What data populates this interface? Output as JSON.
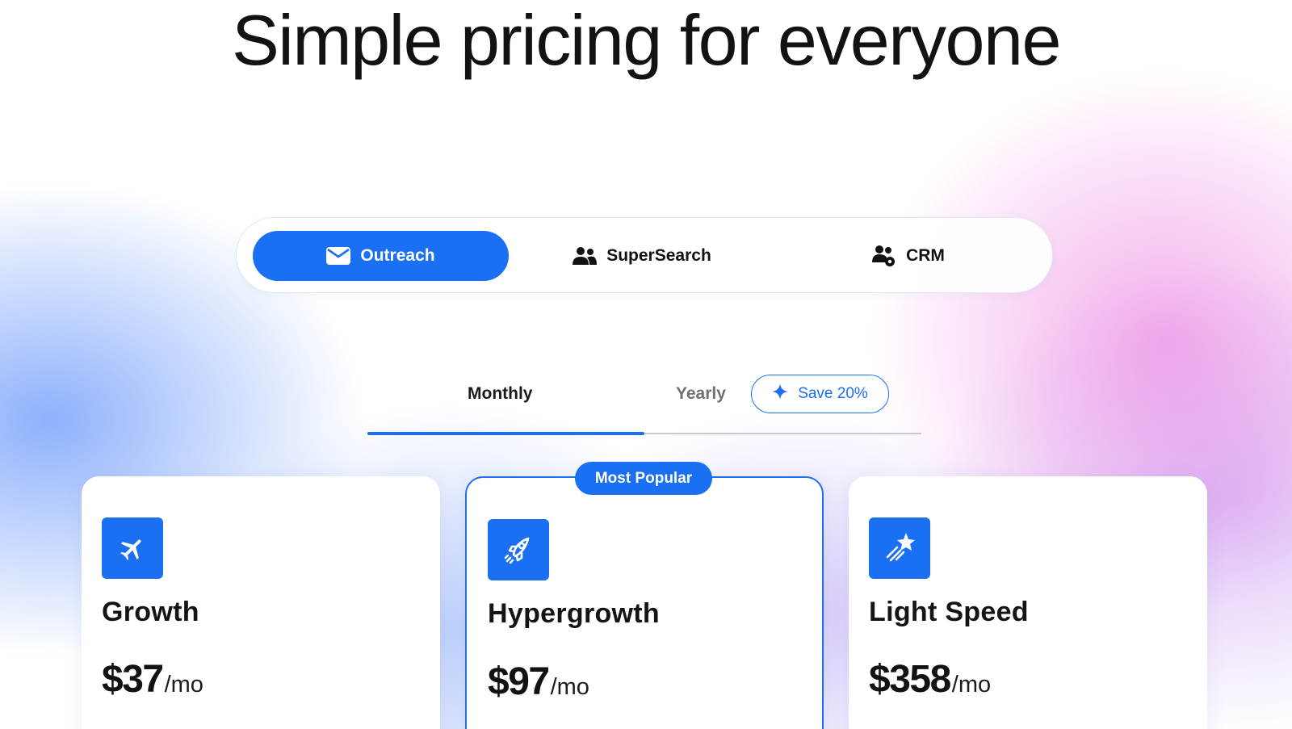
{
  "headline": "Simple pricing for everyone",
  "product_tabs": [
    {
      "label": "Outreach",
      "icon": "envelope-icon",
      "active": true
    },
    {
      "label": "SuperSearch",
      "icon": "users-icon",
      "active": false
    },
    {
      "label": "CRM",
      "icon": "users-gear-icon",
      "active": false
    }
  ],
  "billing": {
    "monthly_label": "Monthly",
    "yearly_label": "Yearly",
    "save_label": "Save 20%",
    "save_icon": "sparkle-icon",
    "selected": "Monthly"
  },
  "popular_badge": "Most Popular",
  "plans": [
    {
      "name": "Growth",
      "price": "$37",
      "unit": "/mo",
      "icon": "airplane-icon"
    },
    {
      "name": "Hypergrowth",
      "price": "$97",
      "unit": "/mo",
      "icon": "rocket-icon",
      "featured": true
    },
    {
      "name": "Light Speed",
      "price": "$358",
      "unit": "/mo",
      "icon": "shooting-star-icon"
    }
  ],
  "colors": {
    "accent": "#1b6ff2",
    "text": "#121212",
    "muted": "#707070"
  }
}
